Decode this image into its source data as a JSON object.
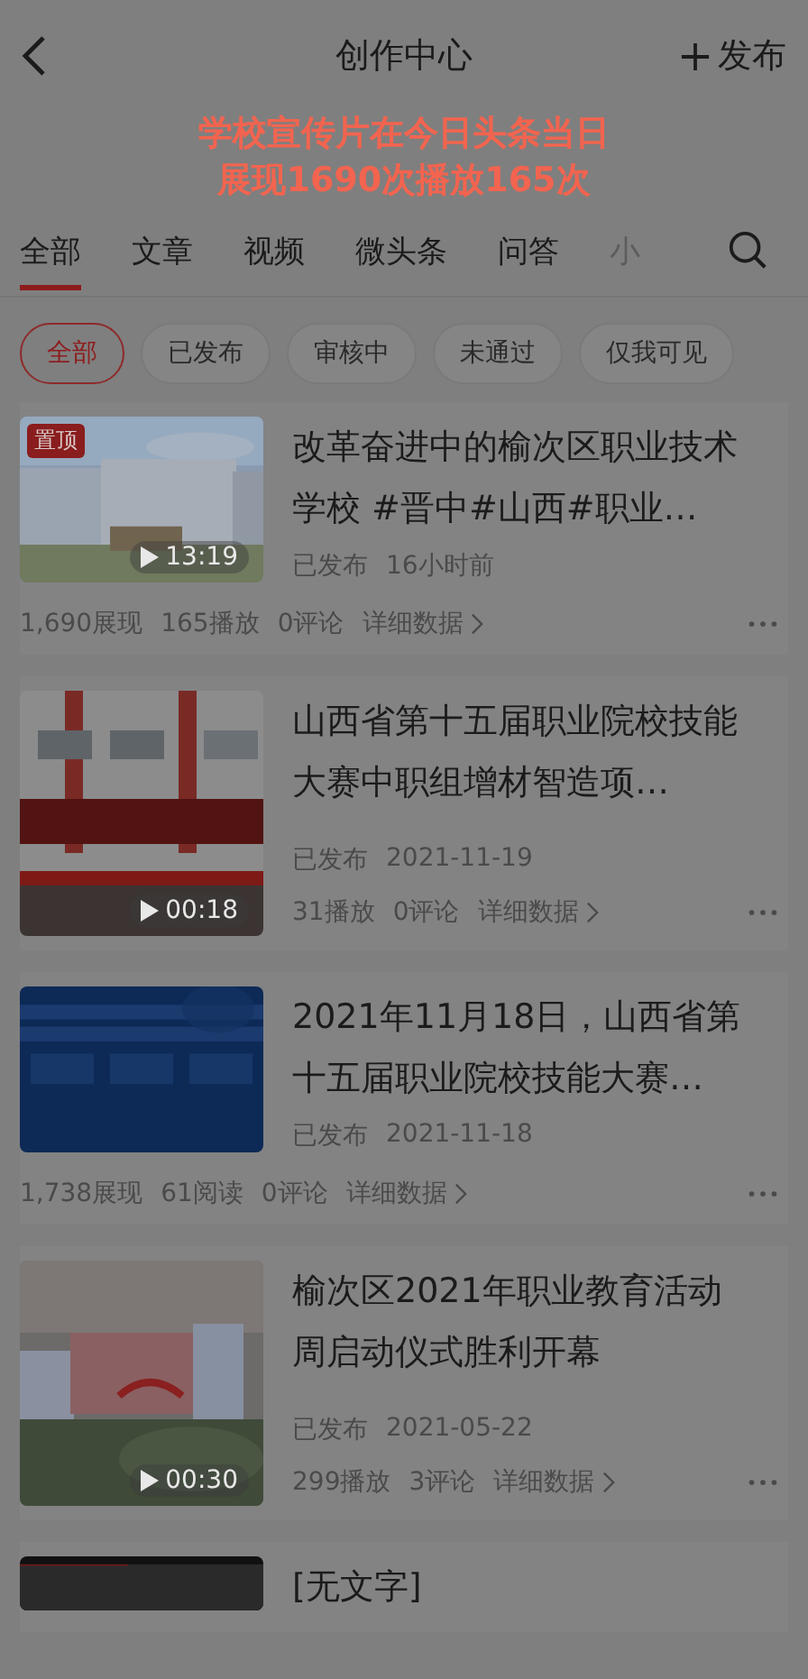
{
  "header": {
    "title": "创作中心",
    "publish": "发布"
  },
  "notice": [
    "学校宣传片在今日头条当日",
    "展现1690次播放165次"
  ],
  "tabs": [
    {
      "label": "全部",
      "selected": true
    },
    {
      "label": "文章",
      "selected": false
    },
    {
      "label": "视频",
      "selected": false
    },
    {
      "label": "微头条",
      "selected": false
    },
    {
      "label": "问答",
      "selected": false
    },
    {
      "label": "小",
      "selected": false
    }
  ],
  "filters": [
    {
      "label": "全部",
      "selected": true
    },
    {
      "label": "已发布",
      "selected": false
    },
    {
      "label": "审核中",
      "selected": false
    },
    {
      "label": "未通过",
      "selected": false
    },
    {
      "label": "仅我可见",
      "selected": false
    }
  ],
  "posts": [
    {
      "kind": "wide",
      "title": "改革奋进中的榆次区职业技术学校 #晋中#山西#职业…",
      "badge": "置顶",
      "duration": "13:19",
      "status": "已发布",
      "time": "16小时前",
      "stats": [
        "1,690展现",
        "165播放",
        "0评论"
      ],
      "details": "详细数据"
    },
    {
      "kind": "tall",
      "title": "山西省第十五届职业院校技能大赛中职组增材智造项…",
      "duration": "00:18",
      "status": "已发布",
      "time": "2021-11-19",
      "stats": [
        "31播放",
        "0评论"
      ],
      "details": "详细数据"
    },
    {
      "kind": "wide",
      "title": "2021年11月18日，山西省第十五届职业院校技能大赛…",
      "status": "已发布",
      "time": "2021-11-18",
      "stats": [
        "1,738展现",
        "61阅读",
        "0评论"
      ],
      "details": "详细数据"
    },
    {
      "kind": "tall",
      "title": "榆次区2021年职业教育活动周启动仪式胜利开幕",
      "duration": "00:30",
      "status": "已发布",
      "time": "2021-05-22",
      "stats": [
        "299播放",
        "3评论"
      ],
      "details": "详细数据"
    },
    {
      "kind": "cut",
      "title": "[无文字]"
    }
  ]
}
